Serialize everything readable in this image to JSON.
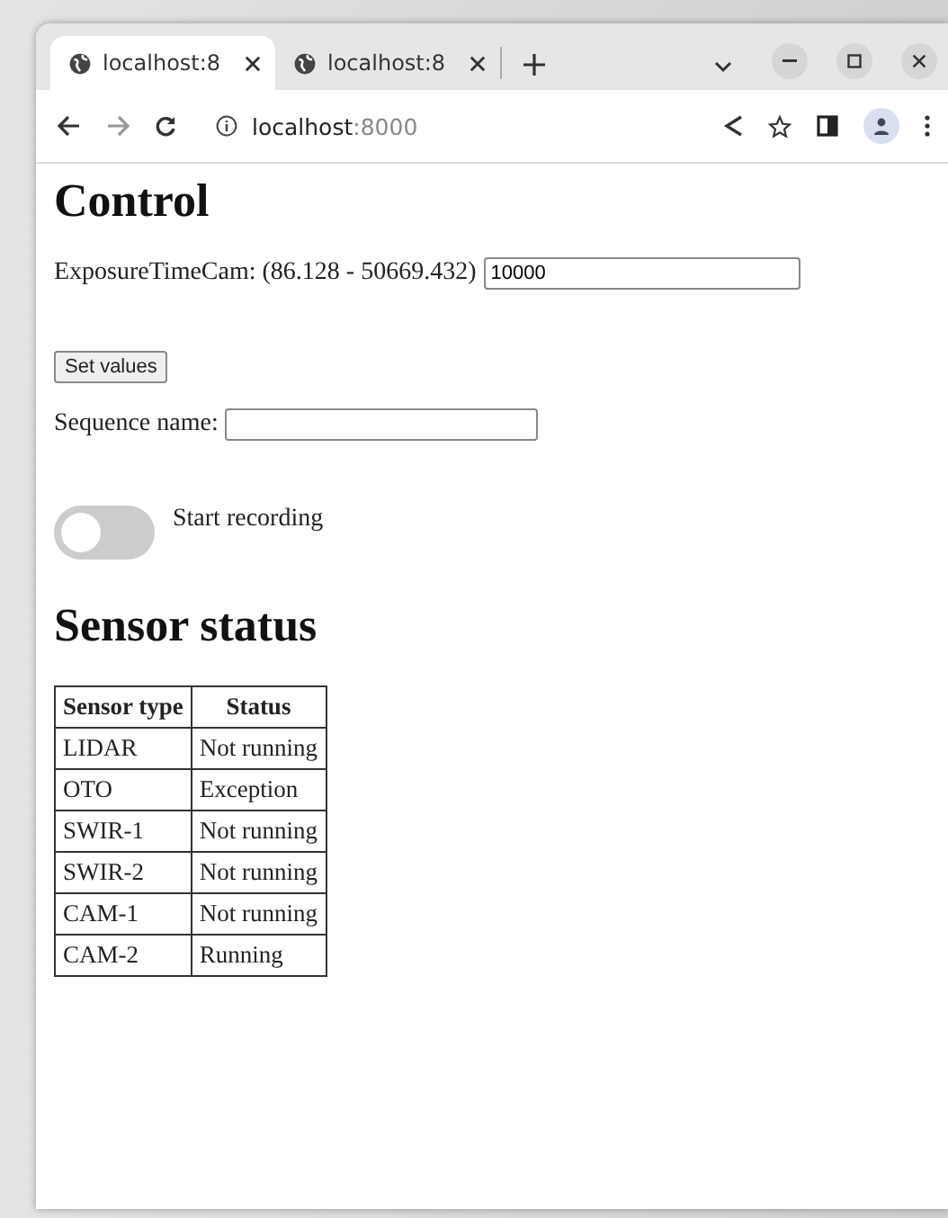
{
  "browser": {
    "tabs": [
      {
        "title": "localhost:8",
        "selected": true
      },
      {
        "title": "localhost:8",
        "selected": false
      }
    ],
    "address": {
      "host": "localhost",
      "port": ":8000"
    }
  },
  "page": {
    "control": {
      "heading": "Control",
      "exposure": {
        "label": "ExposureTimeCam: (86.128 - 50669.432)",
        "value": "10000"
      },
      "set_button": "Set values",
      "sequence": {
        "label": "Sequence name:"
      },
      "recording": {
        "label": "Start recording",
        "on": false
      }
    },
    "status": {
      "heading": "Sensor status",
      "columns": [
        "Sensor type",
        "Status"
      ],
      "rows": [
        [
          "LIDAR",
          "Not running"
        ],
        [
          "OTO",
          "Exception"
        ],
        [
          "SWIR-1",
          "Not running"
        ],
        [
          "SWIR-2",
          "Not running"
        ],
        [
          "CAM-1",
          "Not running"
        ],
        [
          "CAM-2",
          "Running"
        ]
      ]
    }
  }
}
